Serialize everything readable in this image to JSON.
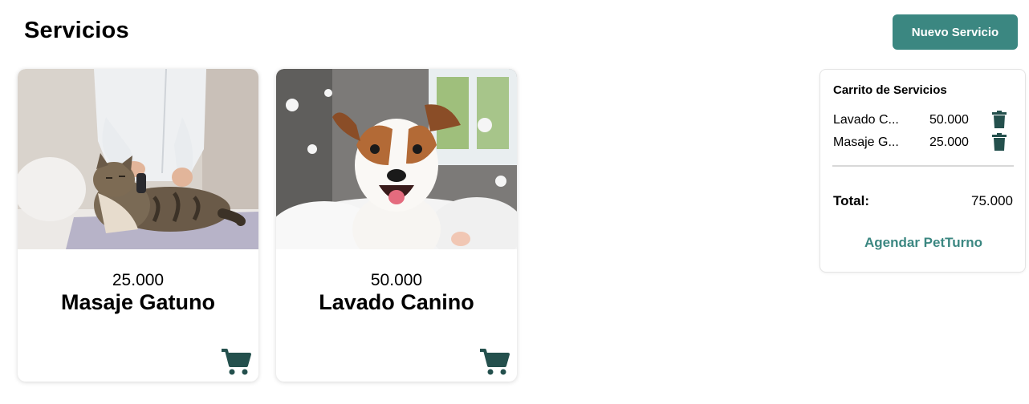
{
  "header": {
    "title": "Servicios",
    "new_service_label": "Nuevo Servicio"
  },
  "services": [
    {
      "price": "25.000",
      "name": "Masaje Gatuno",
      "image": "cat-massage-photo",
      "action_icon": "cart-icon"
    },
    {
      "price": "50.000",
      "name": "Lavado Canino",
      "image": "dog-bath-photo",
      "action_icon": "cart-icon"
    }
  ],
  "cart": {
    "title": "Carrito de Servicios",
    "items": [
      {
        "name": "Lavado C...",
        "price": "50.000",
        "icon": "trash-icon"
      },
      {
        "name": "Masaje G...",
        "price": "25.000",
        "icon": "trash-icon"
      }
    ],
    "total_label": "Total:",
    "total_value": "75.000",
    "action_label": "Agendar PetTurno"
  },
  "colors": {
    "accent": "#3b8781",
    "icon_dark": "#24504d"
  }
}
